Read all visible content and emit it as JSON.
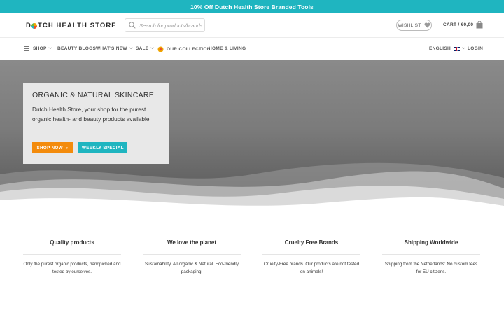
{
  "topbar": {
    "text": "10% Off Dutch Health Store Branded Tools"
  },
  "header": {
    "logo_part1": "D",
    "logo_part2": "TCH HEALTH STORE",
    "search_placeholder": "Search for products/brands",
    "wishlist_label": "WISHLIST",
    "cart_label": "CART / €0,00"
  },
  "nav": {
    "shop": "SHOP",
    "beauty_blogs": "BEAUTY BLOGS",
    "whats_new": "WHAT'S NEW",
    "sale": "SALE",
    "our_collection": "OUR COLLECTION",
    "home_living": "HOME & LIVING",
    "language": "ENGLISH",
    "login": "LOGIN"
  },
  "hero": {
    "title": "ORGANIC & NATURAL SKINCARE",
    "text": "Dutch Health Store, your shop for the purest organic health- and beauty products available!",
    "shop_now": "SHOP NOW",
    "weekly_special": "WEEKLY SPECIAL"
  },
  "features": [
    {
      "title": "Quality products",
      "text": "Only the purest organic products, handpicked and tested by ourselves."
    },
    {
      "title": "We love the planet",
      "text": "Sustainability. All organic & Natural. Eco-friendly packaging."
    },
    {
      "title": "Cruelty Free Brands",
      "text": "Cruelty-Free brands. Our products are not tested on animals!"
    },
    {
      "title": "Shipping Worldwide",
      "text": "Shipping from the Netherlands: No custom fees for EU citizens."
    }
  ],
  "colors": {
    "accent_teal": "#1fb5c0",
    "accent_orange": "#f38b0c"
  }
}
